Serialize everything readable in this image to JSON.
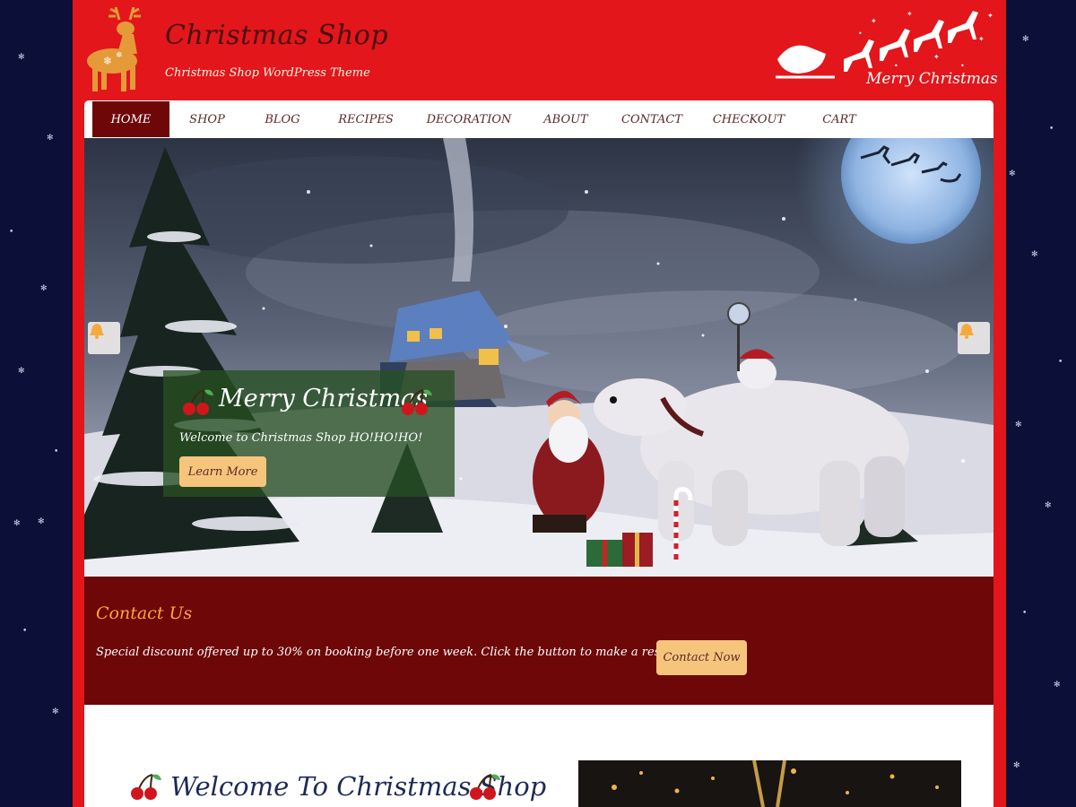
{
  "site": {
    "title": "Christmas Shop",
    "tagline": "Christmas Shop WordPress Theme",
    "header_art_text": "Merry Christmas"
  },
  "nav": {
    "items": [
      {
        "label": "HOME",
        "active": true
      },
      {
        "label": "SHOP",
        "active": false
      },
      {
        "label": "BLOG",
        "active": false
      },
      {
        "label": "RECIPES",
        "active": false
      },
      {
        "label": "DECORATION",
        "active": false
      },
      {
        "label": "ABOUT",
        "active": false
      },
      {
        "label": "CONTACT",
        "active": false
      },
      {
        "label": "CHECKOUT",
        "active": false
      },
      {
        "label": "CART",
        "active": false
      }
    ]
  },
  "slider": {
    "caption_title": "Merry Christmas",
    "caption_subtitle": "Welcome to Christmas Shop HO!HO!HO!",
    "cta_label": "Learn More",
    "prev_icon": "bell-icon",
    "next_icon": "bell-icon"
  },
  "contact": {
    "title": "Contact Us",
    "text": "Special discount offered up to  30% on booking before one week. Click the button to make a reservation.",
    "button_label": "Contact Now"
  },
  "welcome": {
    "title": "Welcome To Christmas Shop"
  },
  "colors": {
    "page_bg": "#0c1038",
    "brand_red": "#e3161b",
    "dark_red": "#6d0708",
    "gold": "#f6c57c",
    "accent_orange": "#f6a93b"
  }
}
